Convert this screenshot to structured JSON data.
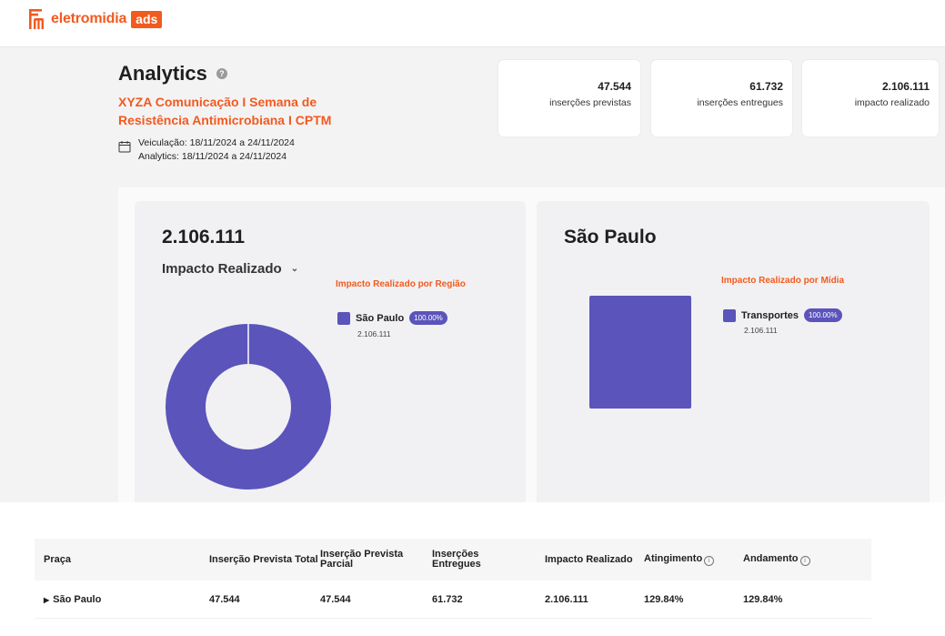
{
  "brand": {
    "name": "eletromidia",
    "badge": "ads",
    "accent": "#f25a1e"
  },
  "header": {
    "title": "Analytics",
    "campaign": "XYZA Comunicação I Semana de Resistência Antimicrobiana I CPTM",
    "veiculacao": "Veiculação: 18/11/2024 a 24/11/2024",
    "analytics_period": "Analytics: 18/11/2024 a 24/11/2024"
  },
  "stats": [
    {
      "value": "47.544",
      "label": "inserções previstas"
    },
    {
      "value": "61.732",
      "label": "inserções entregues"
    },
    {
      "value": "2.106.111",
      "label": "impacto realizado"
    }
  ],
  "left_panel": {
    "total": "2.106.111",
    "metric": "Impacto Realizado",
    "chart_title": "Impacto Realizado por Região",
    "legend": [
      {
        "name": "São Paulo",
        "percent": "100.00%",
        "value": "2.106.111"
      }
    ]
  },
  "right_panel": {
    "region": "São Paulo",
    "chart_title": "Impacto Realizado por Mídia",
    "legend": [
      {
        "name": "Transportes",
        "percent": "100.00%",
        "value": "2.106.111"
      }
    ]
  },
  "chart_data": [
    {
      "type": "pie",
      "categories": [
        "São Paulo"
      ],
      "values": [
        2106111
      ],
      "title": "Impacto Realizado por Região",
      "colors": [
        "#5b54bb"
      ]
    },
    {
      "type": "bar",
      "categories": [
        "Transportes"
      ],
      "values": [
        2106111
      ],
      "title": "Impacto Realizado por Mídia",
      "colors": [
        "#5b54bb"
      ]
    }
  ],
  "table": {
    "headers": {
      "praca": "Praça",
      "prevista_total": "Inserção Prevista Total",
      "prevista_parcial": "Inserção Prevista Parcial",
      "entregues": "Inserções Entregues",
      "impacto": "Impacto Realizado",
      "atingimento": "Atingimento",
      "andamento": "Andamento"
    },
    "rows": [
      {
        "praca": "São Paulo",
        "prevista_total": "47.544",
        "prevista_parcial": "47.544",
        "entregues": "61.732",
        "impacto": "2.106.111",
        "atingimento": "129.84%",
        "andamento": "129.84%"
      }
    ]
  }
}
